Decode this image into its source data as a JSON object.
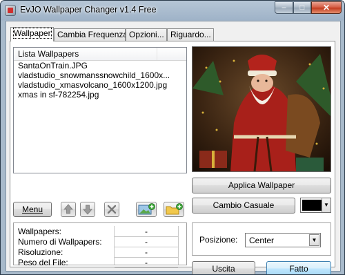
{
  "window": {
    "title": "EvJO Wallpaper Changer v1.4 Free",
    "min_glyph": "–",
    "max_glyph": "□",
    "close_glyph": "✕"
  },
  "tabs": [
    {
      "label": "Wallpaper",
      "active": true
    },
    {
      "label": "Cambia Frequenza",
      "active": false
    },
    {
      "label": "Opzioni...",
      "active": false
    },
    {
      "label": "Riguardo...",
      "active": false
    }
  ],
  "list": {
    "header": "Lista Wallpapers",
    "items": [
      "SantaOnTrain.JPG",
      "vladstudio_snowmanssnowchild_1600x...",
      "vladstudio_xmasvolcano_1600x1200.jpg",
      "xmas in sf-782254.jpg"
    ]
  },
  "toolbar": {
    "menu_label": "Menu",
    "icons": [
      "arrow-up-icon",
      "arrow-down-icon",
      "delete-x-icon",
      "add-image-icon",
      "add-folder-icon"
    ]
  },
  "info": {
    "rows": [
      {
        "label": "Wallpapers:",
        "value": "-"
      },
      {
        "label": "Numero di Wallpapers:",
        "value": "-"
      },
      {
        "label": "Risoluzione:",
        "value": "-"
      },
      {
        "label": "Peso del File:",
        "value": "-"
      }
    ]
  },
  "actions": {
    "apply_label": "Applica Wallpaper",
    "random_label": "Cambio Casuale",
    "exit_label": "Uscita",
    "done_label": "Fatto"
  },
  "position": {
    "label": "Posizione:",
    "value": "Center"
  },
  "colors": {
    "background_color": "#000000",
    "accent_blue": "#3c7fb1"
  }
}
